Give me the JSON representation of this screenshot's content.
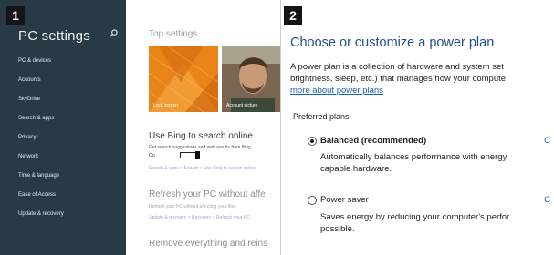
{
  "step_badges": [
    "1",
    "2"
  ],
  "pc_settings": {
    "title": "PC settings",
    "search_icon": "search-icon",
    "nav_items": [
      "PC & devices",
      "Accounts",
      "SkyDrive",
      "Search & apps",
      "Privacy",
      "Network",
      "Time & language",
      "Ease of Access",
      "Update & recovery"
    ],
    "top_settings_heading": "Top settings",
    "tiles": {
      "lock_screen": "Lock screen",
      "account_picture": "Account picture"
    },
    "bing": {
      "heading": "Use Bing to search online",
      "description": "Get search suggestions and web results from Bing",
      "toggle_label": "On",
      "toggle_state": "on",
      "breadcrumb": "Search & apps > Search > Use Bing to search online"
    },
    "refresh": {
      "heading": "Refresh your PC without affe",
      "description": "Refresh your PC without affecting your files",
      "breadcrumb": "Update & recovery > Recovery > Refresh your PC"
    },
    "remove": {
      "heading": "Remove everything and reins"
    },
    "colors": {
      "sidebar": "#283a46",
      "tile_orange": "#e98418"
    }
  },
  "power_plan": {
    "title": "Choose or customize a power plan",
    "desc_line1": "A power plan is a collection of hardware and system set",
    "desc_line2": "brightness, sleep, etc.) that manages how your compute",
    "desc_link": "more about power plans",
    "preferred_label": "Preferred plans",
    "plans": [
      {
        "name": "Balanced (recommended)",
        "selected": true,
        "desc_line1": "Automatically balances performance with energy",
        "desc_line2": "capable hardware.",
        "change_link": "C"
      },
      {
        "name": "Power saver",
        "selected": false,
        "desc_line1": "Saves energy by reducing your computer's perfor",
        "desc_line2": "possible.",
        "change_link": "C"
      }
    ],
    "colors": {
      "title": "#1e4e8c",
      "link": "#1a5fb4"
    }
  }
}
